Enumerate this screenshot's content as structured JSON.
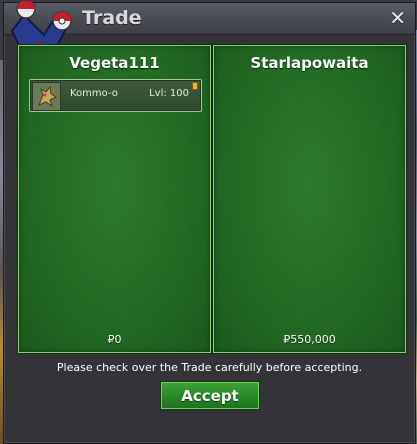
{
  "window": {
    "title": "Trade",
    "close_icon": "close-icon",
    "emblem_icon": "pokeball-emblem-icon"
  },
  "panels": [
    {
      "name": "Vegeta111",
      "currency": "₽0",
      "items": [
        {
          "icon": "pokemon-icon",
          "name": "Kommo-o",
          "level": "Lvl: 100"
        }
      ]
    },
    {
      "name": "Starlapowaita",
      "currency": "₽550,000",
      "items": []
    }
  ],
  "notice": "Please check over the Trade carefully before accepting.",
  "accept_label": "Accept",
  "colors": {
    "panel_green": "#236a24",
    "panel_border": "#8ccf7a",
    "button_green": "#2a8a27"
  }
}
